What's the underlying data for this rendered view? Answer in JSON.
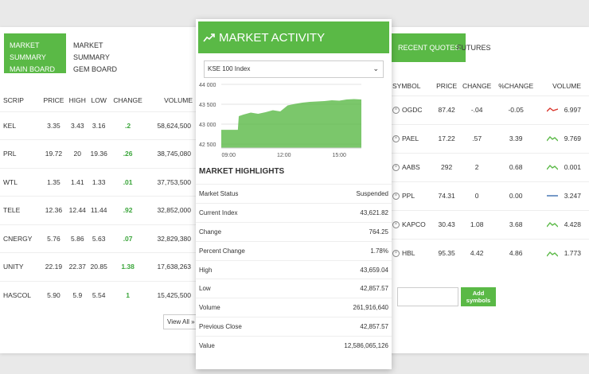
{
  "left_panel": {
    "tabs": [
      {
        "label_line1": "MARKET SUMMARY",
        "label_line2": "MAIN BOARD"
      },
      {
        "label_line1": "MARKET SUMMARY",
        "label_line2": "GEM BOARD"
      }
    ],
    "columns": [
      "SCRIP",
      "PRICE",
      "HIGH",
      "LOW",
      "CHANGE",
      "VOLUME"
    ],
    "rows": [
      {
        "scrip": "KEL",
        "price": "3.35",
        "high": "3.43",
        "low": "3.16",
        "change": ".2",
        "volume": "58,624,500"
      },
      {
        "scrip": "PRL",
        "price": "19.72",
        "high": "20",
        "low": "19.36",
        "change": ".26",
        "volume": "38,745,080"
      },
      {
        "scrip": "WTL",
        "price": "1.35",
        "high": "1.41",
        "low": "1.33",
        "change": ".01",
        "volume": "37,753,500"
      },
      {
        "scrip": "TELE",
        "price": "12.36",
        "high": "12.44",
        "low": "11.44",
        "change": ".92",
        "volume": "32,852,000"
      },
      {
        "scrip": "CNERGY",
        "price": "5.76",
        "high": "5.86",
        "low": "5.63",
        "change": ".07",
        "volume": "32,829,380"
      },
      {
        "scrip": "UNITY",
        "price": "22.19",
        "high": "22.37",
        "low": "20.85",
        "change": "1.38",
        "volume": "17,638,263"
      },
      {
        "scrip": "HASCOL",
        "price": "5.90",
        "high": "5.9",
        "low": "5.54",
        "change": "1",
        "volume": "15,425,500"
      }
    ],
    "view_all_label": "View All »"
  },
  "mid_panel": {
    "title": "MARKET ACTIVITY",
    "index_select": "KSE 100 Index",
    "highlights_title": "MARKET HIGHLIGHTS",
    "highlights": [
      {
        "label": "Market Status",
        "value": "Suspended"
      },
      {
        "label": "Current Index",
        "value": "43,621.82"
      },
      {
        "label": "Change",
        "value": "764.25"
      },
      {
        "label": "Percent Change",
        "value": "1.78%"
      },
      {
        "label": "High",
        "value": "43,659.04"
      },
      {
        "label": "Low",
        "value": "42,857.57"
      },
      {
        "label": "Volume",
        "value": "261,916,640"
      },
      {
        "label": "Previous Close",
        "value": "42,857.57"
      },
      {
        "label": "Value",
        "value": "12,586,065,126"
      }
    ]
  },
  "chart_data": {
    "type": "area",
    "x_ticks": [
      "09:00",
      "12:00",
      "15:00"
    ],
    "y_ticks": [
      "44 000",
      "43 500",
      "43 000",
      "42 500"
    ],
    "ylim": [
      42400,
      44000
    ],
    "x": [
      8.6,
      9.5,
      9.55,
      9.8,
      10.2,
      10.6,
      11.0,
      11.4,
      11.8,
      12.2,
      12.6,
      13.0,
      13.4,
      13.8,
      14.2,
      14.6,
      15.0,
      15.4,
      15.8,
      16.2
    ],
    "y": [
      42857,
      42857,
      43200,
      43240,
      43290,
      43260,
      43300,
      43350,
      43320,
      43470,
      43510,
      43540,
      43560,
      43570,
      43580,
      43600,
      43590,
      43621,
      43630,
      43621
    ],
    "color": "#5ab946"
  },
  "right_panel": {
    "tabs": [
      {
        "label": "RECENT QUOTES"
      },
      {
        "label": "FUTURES"
      }
    ],
    "columns": [
      "SYMBOL",
      "PRICE",
      "CHANGE",
      "%CHANGE",
      "VOLUME"
    ],
    "rows": [
      {
        "symbol": "OGDC",
        "price": "87.42",
        "change": "-.04",
        "pct": "-0.05",
        "volume": "6.997",
        "trend": "down"
      },
      {
        "symbol": "PAEL",
        "price": "17.22",
        "change": ".57",
        "pct": "3.39",
        "volume": "9.769",
        "trend": "up"
      },
      {
        "symbol": "AABS",
        "price": "292",
        "change": "2",
        "pct": "0.68",
        "volume": "0.001",
        "trend": "up"
      },
      {
        "symbol": "PPL",
        "price": "74.31",
        "change": "0",
        "pct": "0.00",
        "volume": "3.247",
        "trend": "flat"
      },
      {
        "symbol": "KAPCO",
        "price": "30.43",
        "change": "1.08",
        "pct": "3.68",
        "volume": "4.428",
        "trend": "up"
      },
      {
        "symbol": "HBL",
        "price": "95.35",
        "change": "4.42",
        "pct": "4.86",
        "volume": "1.773",
        "trend": "up"
      }
    ],
    "add_button_label": "Add symbols"
  },
  "colors": {
    "accent": "#5ab946",
    "down": "#d9342b",
    "flat": "#3a6fb0"
  }
}
